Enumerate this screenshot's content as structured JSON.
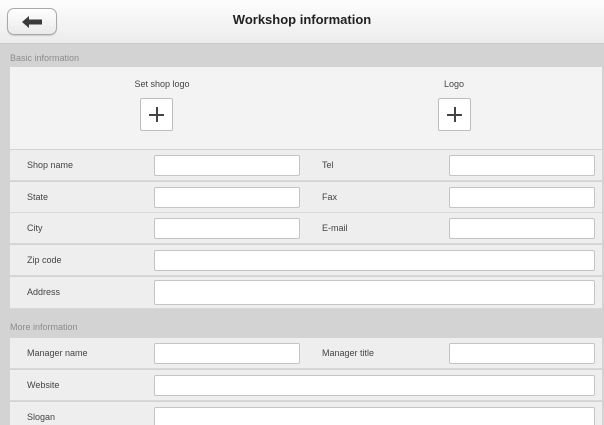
{
  "header": {
    "title": "Workshop information",
    "back_icon": "arrow-left-icon"
  },
  "basic": {
    "section_label": "Basic information",
    "set_shop_logo": "Set shop logo",
    "logo": "Logo",
    "shop_name": "Shop name",
    "tel": "Tel",
    "state": "State",
    "fax": "Fax",
    "city": "City",
    "email": "E-mail",
    "zip_code": "Zip code",
    "address": "Address"
  },
  "more": {
    "section_label": "More information",
    "manager_name": "Manager name",
    "manager_title": "Manager title",
    "website": "Website",
    "slogan": "Slogan"
  },
  "fields": {
    "shop_name": "",
    "tel": "",
    "state": "",
    "fax": "",
    "city": "",
    "email": "",
    "zip_code": "",
    "address": "",
    "manager_name": "",
    "manager_title": "",
    "website": "",
    "slogan": ""
  }
}
